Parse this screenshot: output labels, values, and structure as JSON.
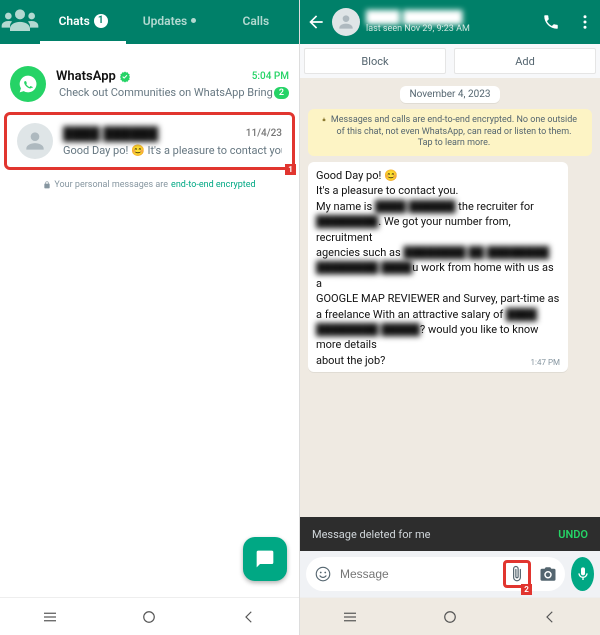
{
  "left": {
    "tabs": {
      "chats": "Chats",
      "chats_badge": "1",
      "updates": "Updates",
      "calls": "Calls"
    },
    "items": [
      {
        "name": "WhatsApp",
        "time": "5:04 PM",
        "preview": "Check out Communities on WhatsApp Bring peop…",
        "unread": "2"
      },
      {
        "name_blur": "████ ██████",
        "time": "11/4/23",
        "preview": "Good Day po! 😊 It's a pleasure to contact you. My name i…"
      }
    ],
    "encryption_pre": "Your personal messages are ",
    "encryption_link": "end-to-end encrypted",
    "highlight_badge_1": "1"
  },
  "right": {
    "header_name_blur": "████ ███████",
    "header_status": "last seen Nov 29, 9:23 AM",
    "block": "Block",
    "add": "Add",
    "date_pill": "November 4, 2023",
    "e2e_banner": "Messages and calls are end-to-end encrypted. No one outside of this chat, not even WhatsApp, can read or listen to them. Tap to learn more.",
    "msg": {
      "l1": "Good Day po! 😊",
      "l2": "It's a pleasure to contact you.",
      "l3a": "My name is ",
      "l3b_blur": "████ ██████",
      "l3c": " the recruiter for",
      "l4_blur": "████████",
      "l4b": ". We got your number from, recruitment",
      "l5a": "agencies such as ",
      "l5b_blur": "████████ ██ ████████",
      "l6_blur": "████████ ████",
      "l6b": "u work from home with us as a",
      "l7": "GOOGLE MAP REVIEWER and Survey, part-time as",
      "l8a": "a freelance With an attractive salary of ",
      "l8b_blur": "████",
      "l9_blur": "████████ █████",
      "l9b": "? would you like to know more details",
      "l10": "about the job?",
      "time": "1:47 PM"
    },
    "deleted_label": "Message deleted for me",
    "undo": "UNDO",
    "input_placeholder": "Message",
    "highlight_badge_2": "2"
  }
}
